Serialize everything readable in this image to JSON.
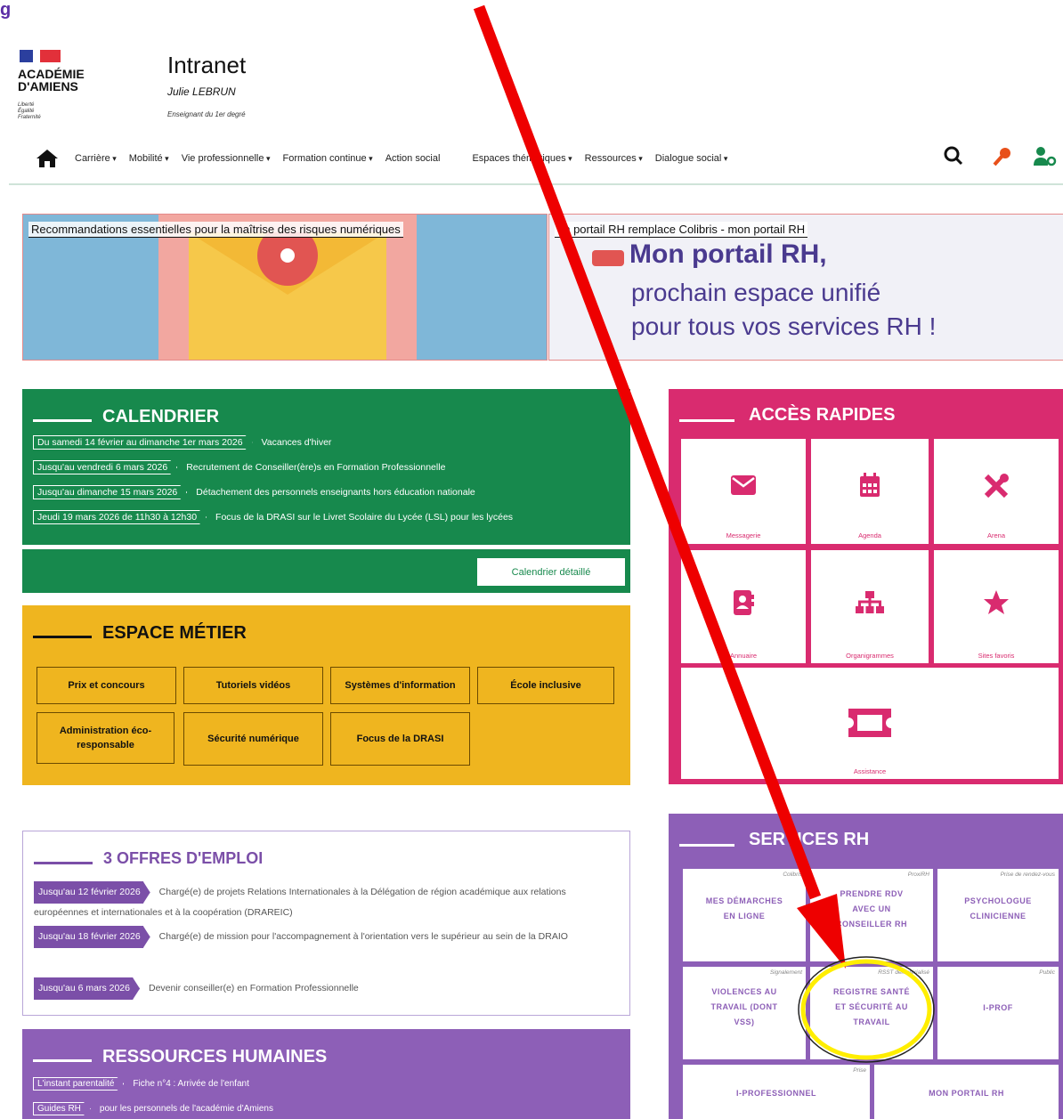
{
  "page_top_cut": "g",
  "header": {
    "logo": {
      "line1": "ACADÉMIE",
      "line2": "D'AMIENS",
      "motto": [
        "Liberté",
        "Égalité",
        "Fraternité"
      ]
    },
    "title": "Intranet",
    "user_name": "Julie LEBRUN",
    "user_role": "Enseignant du 1er degré",
    "nav": [
      "Carrière",
      "Mobilité",
      "Vie professionnelle",
      "Formation continue",
      "Action social",
      "Espaces thématiques",
      "Ressources",
      "Dialogue social"
    ],
    "tool_icons": [
      "search-icon",
      "key-icon",
      "user-settings-icon"
    ]
  },
  "carousel": {
    "slide1_caption": "Recommandations essentielles pour la maîtrise des risques numériques",
    "slide2_caption": "on portail RH remplace Colibris - mon portail RH",
    "slide2_big": "Mon portail RH,",
    "slide2_line2": "prochain espace unifié",
    "slide2_line3": "pour tous vos services RH !"
  },
  "calendar": {
    "title": "CALENDRIER",
    "events": [
      {
        "date": "Du samedi 14 février au dimanche 1er mars 2026",
        "text": "Vacances d'hiver"
      },
      {
        "date": "Jusqu'au vendredi 6 mars 2026",
        "text": "Recrutement de Conseiller(ère)s en Formation Professionnelle"
      },
      {
        "date": "Jusqu'au dimanche 15 mars 2026",
        "text": "Détachement des personnels enseignants hors éducation nationale"
      },
      {
        "date": "Jeudi 19 mars 2026 de 11h30 à 12h30",
        "text": "Focus de la DRASI sur le Livret Scolaire du Lycée (LSL) pour les lycées"
      }
    ],
    "button": "Calendrier détaillé"
  },
  "espace_metier": {
    "title": "ESPACE MÉTIER",
    "buttons": [
      "Prix et concours",
      "Tutoriels vidéos",
      "Systèmes d'information",
      "École inclusive",
      "Administration éco-responsable",
      "Sécurité numérique",
      "Focus de la DRASI"
    ]
  },
  "offres": {
    "title": "3 OFFRES D'EMPLOI",
    "items": [
      {
        "date": "Jusqu'au 12 février 2026",
        "text": "Chargé(e) de projets Relations Internationales à la Délégation de région académique aux relations européennes et internationales et à la coopération (DRAREIC)"
      },
      {
        "date": "Jusqu'au 18 février 2026",
        "text": "Chargé(e) de mission pour l'accompagnement à l'orientation vers le supérieur au sein de la DRAIO"
      },
      {
        "date": "Jusqu'au 6 mars 2026",
        "text": "Devenir conseiller(e) en Formation Professionnelle"
      }
    ]
  },
  "ressources": {
    "title": "RESSOURCES HUMAINES",
    "items": [
      {
        "tag": "L'instant parentalité",
        "text": "Fiche n°4 : Arrivée de l'enfant"
      },
      {
        "tag": "Guides RH",
        "text": "pour les personnels de l'académie d'Amiens"
      }
    ]
  },
  "acces_rapides": {
    "title": "ACCÈS RAPIDES",
    "tiles": [
      {
        "label": "Messagerie",
        "icon": "envelope-icon"
      },
      {
        "label": "Agenda",
        "icon": "calendar-icon"
      },
      {
        "label": "Arena",
        "icon": "tools-icon"
      },
      {
        "label": "Annuaire",
        "icon": "address-book-icon"
      },
      {
        "label": "Organigrammes",
        "icon": "org-chart-icon"
      },
      {
        "label": "Sites favoris",
        "icon": "star-icon"
      },
      {
        "label": "Assistance",
        "icon": "ticket-icon"
      }
    ]
  },
  "services_rh": {
    "title": "SERVICES RH",
    "tiles": [
      {
        "tag": "Colibris",
        "label": [
          "MES DÉMARCHES",
          "EN LIGNE"
        ]
      },
      {
        "tag": "ProxiRH",
        "label": [
          "PRENDRE RDV",
          "AVEC UN",
          "CONSEILLER RH"
        ]
      },
      {
        "tag": "Prise de rendez-vous",
        "label": [
          "PSYCHOLOGUE",
          "CLINICIENNE"
        ]
      },
      {
        "tag": "Signalement",
        "label": [
          "VIOLENCES AU",
          "TRAVAIL (DONT",
          "VSS)"
        ]
      },
      {
        "tag": "RSST dématérialisé",
        "label": [
          "REGISTRE SANTÉ",
          "ET SÉCURITÉ AU",
          "TRAVAIL"
        ]
      },
      {
        "tag": "Public",
        "label": [
          "I-PROF"
        ]
      },
      {
        "tag": "Prise",
        "label": [
          "I-PROFESSIONNEL"
        ]
      },
      {
        "tag": "",
        "label": [
          "MON PORTAIL RH"
        ]
      }
    ]
  },
  "colors": {
    "green": "#17894d",
    "yellow": "#efb51f",
    "pink": "#d92b6f",
    "purple": "#8d5fb7",
    "arrow": "#ee0000",
    "highlight": "#ffee00"
  }
}
